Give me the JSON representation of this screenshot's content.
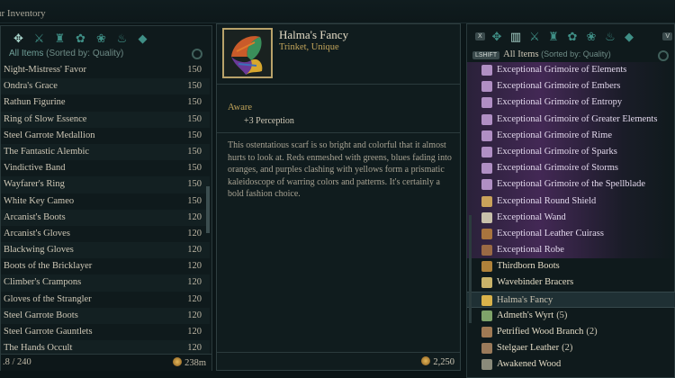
{
  "window": {
    "title": "ur Inventory"
  },
  "left_panel": {
    "filter_label": "All Items",
    "sort_label": "(Sorted by: Quality)",
    "categories": [
      "all-items-icon",
      "weapons-icon",
      "armor-icon",
      "trinkets-icon",
      "materials-icon",
      "consumables-icon",
      "gems-icon"
    ],
    "items": [
      {
        "name": "Night-Mistress' Favor",
        "value": "150"
      },
      {
        "name": "Ondra's Grace",
        "value": "150"
      },
      {
        "name": "Rathun Figurine",
        "value": "150"
      },
      {
        "name": "Ring of Slow Essence",
        "value": "150"
      },
      {
        "name": "Steel Garrote Medallion",
        "value": "150"
      },
      {
        "name": "The Fantastic Alembic",
        "value": "150"
      },
      {
        "name": "Vindictive Band",
        "value": "150"
      },
      {
        "name": "Wayfarer's Ring",
        "value": "150"
      },
      {
        "name": "White Key Cameo",
        "value": "150"
      },
      {
        "name": "Arcanist's Boots",
        "value": "120"
      },
      {
        "name": "Arcanist's Gloves",
        "value": "120"
      },
      {
        "name": "Blackwing Gloves",
        "value": "120"
      },
      {
        "name": "Boots of the Bricklayer",
        "value": "120"
      },
      {
        "name": "Climber's Crampons",
        "value": "120"
      },
      {
        "name": "Gloves of the Strangler",
        "value": "120"
      },
      {
        "name": "Steel Garrote Boots",
        "value": "120"
      },
      {
        "name": "Steel Garrote Gauntlets",
        "value": "120"
      },
      {
        "name": "The Hands Occult",
        "value": "120"
      }
    ],
    "capacity": ".8 / 240",
    "gold": "238m"
  },
  "detail": {
    "name": "Halma's Fancy",
    "type": "Trinket, Unique",
    "perk_name": "Aware",
    "perk_value": "+3 Perception",
    "description": "This ostentatious scarf is so bright and colorful that it almost hurts to look at. Reds enmeshed with greens, blues fading into oranges, and purples clashing with yellows form a prismatic kaleidoscope of warring colors and patterns. It's certainly a bold fashion choice.",
    "price": "2,250"
  },
  "right_panel": {
    "key_hint_top": "X",
    "key_hint_right": "V",
    "shift_key": "LSHIFT",
    "filter_label": "All Items",
    "sort_label": "(Sorted by: Quality)",
    "categories": [
      "all-items-icon",
      "weapons-icon",
      "armor-icon",
      "trinkets-icon",
      "materials-icon",
      "consumables-icon",
      "gems-icon"
    ],
    "items": [
      {
        "name": "Exceptional Grimoire of Elements",
        "icon": "grimoire-icon",
        "style": "ex"
      },
      {
        "name": "Exceptional Grimoire of Embers",
        "icon": "grimoire-icon",
        "style": "ex"
      },
      {
        "name": "Exceptional Grimoire of Entropy",
        "icon": "grimoire-icon",
        "style": "ex"
      },
      {
        "name": "Exceptional Grimoire of Greater Elements",
        "icon": "grimoire-icon",
        "style": "ex"
      },
      {
        "name": "Exceptional Grimoire of Rime",
        "icon": "grimoire-icon",
        "style": "ex"
      },
      {
        "name": "Exceptional Grimoire of Sparks",
        "icon": "grimoire-icon",
        "style": "ex"
      },
      {
        "name": "Exceptional Grimoire of Storms",
        "icon": "grimoire-icon",
        "style": "ex"
      },
      {
        "name": "Exceptional Grimoire of the Spellblade",
        "icon": "grimoire-icon",
        "style": "ex"
      },
      {
        "name": "Exceptional Round Shield",
        "icon": "shield-icon",
        "style": "ex"
      },
      {
        "name": "Exceptional Wand",
        "icon": "wand-icon",
        "style": "ex"
      },
      {
        "name": "Exceptional Leather Cuirass",
        "icon": "cuirass-icon",
        "style": "ex"
      },
      {
        "name": "Exceptional Robe",
        "icon": "robe-icon",
        "style": "ex"
      },
      {
        "name": "Thirdborn Boots",
        "icon": "boots-icon",
        "style": "norm"
      },
      {
        "name": "Wavebinder Bracers",
        "icon": "bracers-icon",
        "style": "norm"
      },
      {
        "name": "Halma's Fancy",
        "icon": "trinket-icon",
        "style": "sel"
      },
      {
        "name": "Admeth's Wyrt",
        "count": "(5)",
        "icon": "herb-icon",
        "style": "norm"
      },
      {
        "name": "Petrified Wood Branch",
        "count": "(2)",
        "icon": "branch-icon",
        "style": "norm"
      },
      {
        "name": "Stelgaer Leather",
        "count": "(2)",
        "icon": "leather-icon",
        "style": "norm"
      },
      {
        "name": "Awakened Wood",
        "icon": "wood-icon",
        "style": "norm"
      }
    ]
  },
  "colors": {
    "gold_text": "#c1a45a",
    "selection": "#1f3034",
    "exceptional_glow": "#6e3484"
  }
}
